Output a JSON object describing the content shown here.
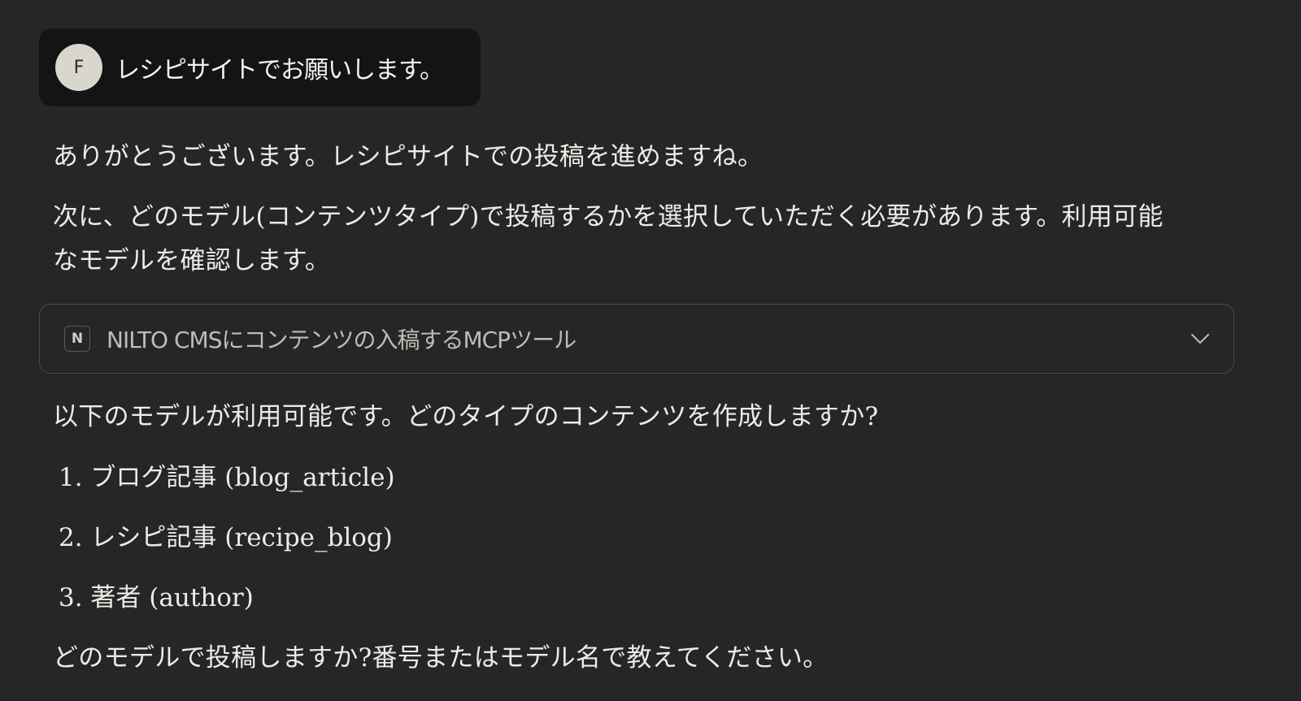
{
  "user_message": {
    "avatar_initial": "F",
    "text": "レシピサイトでお願いします。"
  },
  "assistant": {
    "para1": "ありがとうございます。レシピサイトでの投稿を進めますね。",
    "para2": "次に、どのモデル(コンテンツタイプ)で投稿するかを選択していただく必要があります。利用可能なモデルを確認します。",
    "tool": {
      "icon_letter": "N",
      "label": "NILTO CMSにコンテンツの入稿するMCPツール",
      "chevron_icon": "chevron-down-icon"
    },
    "para3": "以下のモデルが利用可能です。どのタイプのコンテンツを作成しますか?",
    "list": [
      "1. ブログ記事 (blog_article)",
      "2. レシピ記事 (recipe_blog)",
      "3. 著者 (author)"
    ],
    "para4": "どのモデルで投稿しますか?番号またはモデル名で教えてください。"
  }
}
